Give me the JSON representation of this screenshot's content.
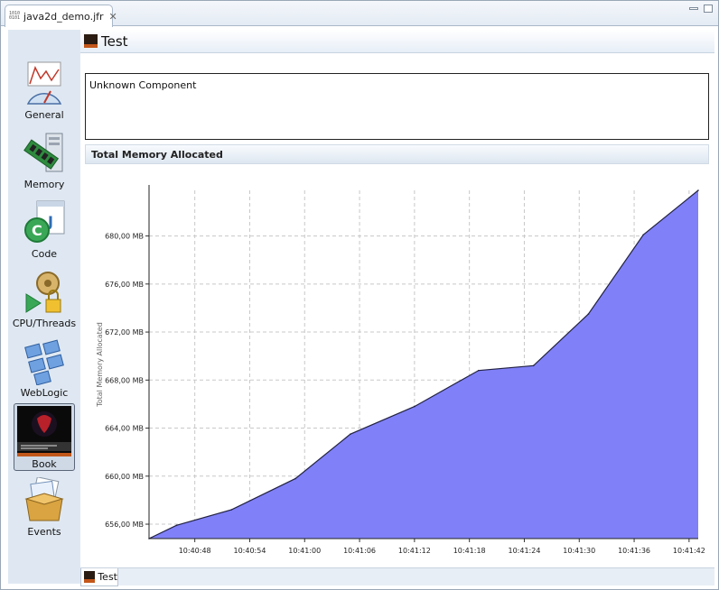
{
  "editor": {
    "tab_label": "java2d_demo.jfr",
    "close_glyph": "✕"
  },
  "sidebar": {
    "items": [
      {
        "label": "General",
        "icon": "general-gauge-icon"
      },
      {
        "label": "Memory",
        "icon": "memory-chip-icon"
      },
      {
        "label": "Code",
        "icon": "code-icon"
      },
      {
        "label": "CPU/Threads",
        "icon": "cpu-threads-icon"
      },
      {
        "label": "WebLogic",
        "icon": "weblogic-icon"
      },
      {
        "label": "Book",
        "icon": "book-icon",
        "active": true
      },
      {
        "label": "Events",
        "icon": "events-box-icon"
      }
    ]
  },
  "page": {
    "title": "Test"
  },
  "unknown_component": {
    "text": "Unknown Component"
  },
  "section": {
    "title": "Total Memory Allocated"
  },
  "bottom_tab": {
    "label": "Test"
  },
  "colors": {
    "fill": "#8080f8",
    "line": "#222244",
    "sidebar_bg": "#dfe8f2"
  },
  "chart_data": {
    "type": "area",
    "title": "",
    "ylabel": "Total Memory Allocated",
    "xlabel": "",
    "x_ticks": [
      "10:40:48",
      "10:40:54",
      "10:41:00",
      "10:41:06",
      "10:41:12",
      "10:41:18",
      "10:41:24",
      "10:41:30",
      "10:41:36",
      "10:41:42"
    ],
    "y_ticks": [
      "656,00 MB",
      "660,00 MB",
      "664,00 MB",
      "668,00 MB",
      "672,00 MB",
      "676,00 MB",
      "680,00 MB"
    ],
    "ylim": [
      654.8,
      683.8
    ],
    "grid": true,
    "x": [
      "10:40:43",
      "10:40:46",
      "10:40:52",
      "10:40:59",
      "10:41:05",
      "10:41:12",
      "10:41:19",
      "10:41:25",
      "10:41:31",
      "10:41:37",
      "10:41:43"
    ],
    "values": [
      654.8,
      655.9,
      657.2,
      659.8,
      663.5,
      665.8,
      668.8,
      669.2,
      673.5,
      680.1,
      683.8
    ]
  }
}
